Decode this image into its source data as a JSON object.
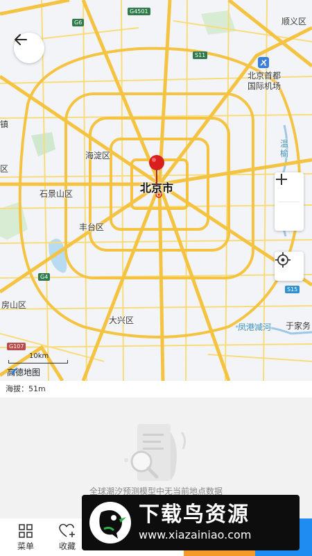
{
  "map": {
    "labels": {
      "shunyi": "顺义区",
      "airport_line1": "北京首都",
      "airport_line2": "国际机场",
      "zhen": "镇",
      "haidian": "海淀区",
      "wen_yu": "温榆",
      "qu_left": "区",
      "beijing": "北京市",
      "shijingshan": "石景山区",
      "fengtai": "丰台区",
      "fangshan": "房山区",
      "daxing": "大兴区",
      "fenggang": "凤港减河",
      "yujia": "于家务"
    },
    "shields": {
      "g4501": "G4501",
      "g6": "G6",
      "s11": "S11",
      "g4": "G4",
      "s15": "S15",
      "g107": "G107"
    },
    "scale": "10km",
    "logo": "高德地图"
  },
  "altitude": "海拔：51m",
  "empty_state": {
    "message": "全球潮汐预测模型中无当前地点数据"
  },
  "bottom_bar": {
    "menu_label": "菜单",
    "favorite_label": "收藏"
  },
  "watermark": {
    "main": "下载鸟资源",
    "sub": "www.xiazainiao.com"
  },
  "colors": {
    "road_major": "#f5c342",
    "road_minor": "#f9dc7a",
    "pin": "#d81e1e",
    "cta_orange": "#f39a2b",
    "cta_blue": "#1e8cf0"
  }
}
